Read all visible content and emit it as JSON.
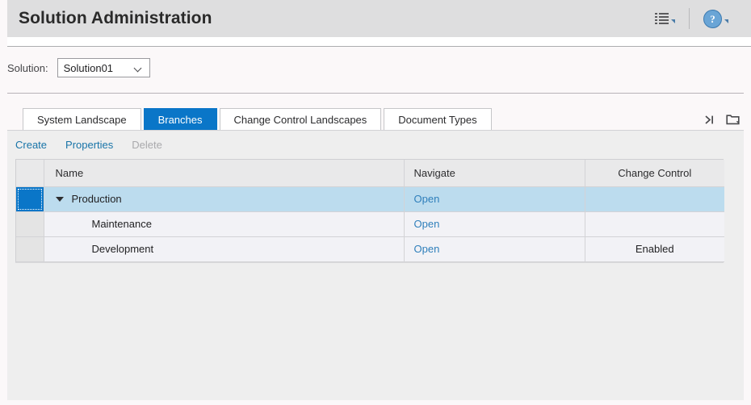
{
  "header": {
    "title": "Solution Administration",
    "actions": [
      {
        "name": "menu-list",
        "icon": "list-icon",
        "has_caret": true
      },
      {
        "name": "help",
        "icon": "help-icon",
        "glyph": "?",
        "has_caret": true
      }
    ]
  },
  "solution_bar": {
    "label": "Solution:",
    "selected": "Solution01",
    "options": [
      "Solution01"
    ]
  },
  "tabs": [
    {
      "label": "System Landscape",
      "active": false
    },
    {
      "label": "Branches",
      "active": true
    },
    {
      "label": "Change Control Landscapes",
      "active": false
    },
    {
      "label": "Document Types",
      "active": false
    }
  ],
  "tab_actions": [
    {
      "name": "collapse-to-end-icon",
      "glyph": "›|"
    },
    {
      "name": "open-in-folder-icon",
      "glyph": "folder"
    }
  ],
  "toolbar": {
    "create_label": "Create",
    "properties_label": "Properties",
    "delete_label": "Delete"
  },
  "table": {
    "columns": [
      "",
      "Name",
      "Navigate",
      "Change Control"
    ],
    "rows": [
      {
        "name": "Production",
        "navigate": "Open",
        "change_control": "",
        "selected": true,
        "level": 0,
        "expanded": true
      },
      {
        "name": "Maintenance",
        "navigate": "Open",
        "change_control": "",
        "selected": false,
        "level": 1,
        "expanded": false
      },
      {
        "name": "Development",
        "navigate": "Open",
        "change_control": "Enabled",
        "selected": false,
        "level": 1,
        "expanded": false
      }
    ]
  },
  "colors": {
    "accent_blue": "#0a76c8",
    "link_blue": "#1874a8",
    "row_selected": "#bcdcee",
    "header_bar": "#dededf",
    "panel_bg": "#eeeeee"
  }
}
